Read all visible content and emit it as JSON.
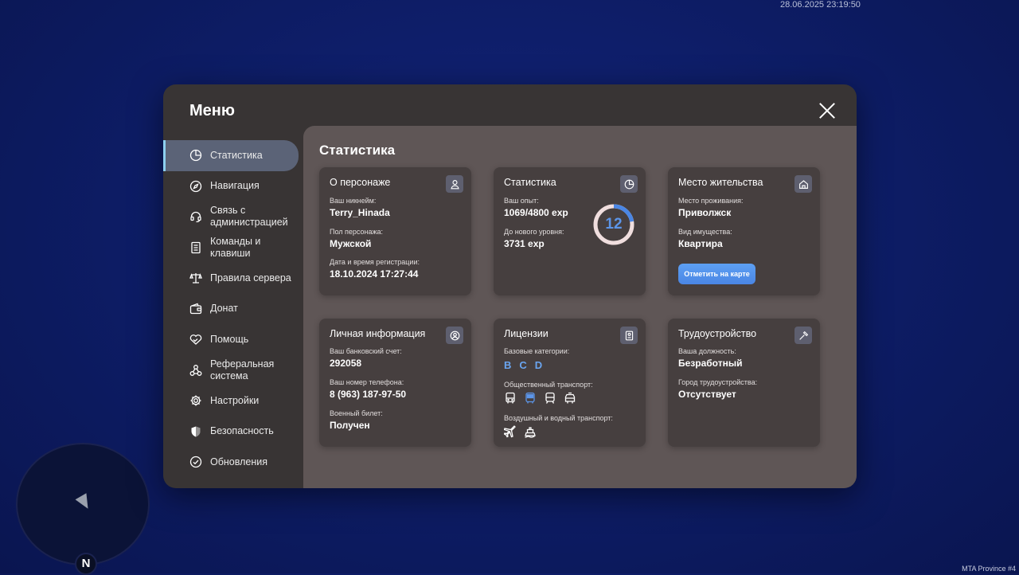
{
  "timestamp": "28.06.2025 23:19:50",
  "watermark": "MTA Province #4",
  "minimap": {
    "north_label": "N"
  },
  "menu": {
    "title": "Меню",
    "sidebar": [
      {
        "label": "Статистика",
        "icon": "pie-chart-icon",
        "active": true
      },
      {
        "label": "Навигация",
        "icon": "compass-icon"
      },
      {
        "label": "Связь с\nадминистрацией",
        "icon": "headset-icon"
      },
      {
        "label": "Команды и\nклавиши",
        "icon": "document-icon"
      },
      {
        "label": "Правила сервера",
        "icon": "scales-icon"
      },
      {
        "label": "Донат",
        "icon": "wallet-icon"
      },
      {
        "label": "Помощь",
        "icon": "handshake-heart-icon"
      },
      {
        "label": "Реферальная\nсистема",
        "icon": "network-icon"
      },
      {
        "label": "Настройки",
        "icon": "gear-icon"
      },
      {
        "label": "Безопасность",
        "icon": "shield-icon"
      },
      {
        "label": "Обновления",
        "icon": "check-circle-icon"
      }
    ]
  },
  "content": {
    "title": "Статистика",
    "character": {
      "title": "О персонаже",
      "nickname_label": "Ваш никнейм:",
      "nickname": "Terry_Hinada",
      "gender_label": "Пол персонажа:",
      "gender": "Мужской",
      "reg_label": "Дата и время регистрации:",
      "reg": "18.10.2024 17:27:44"
    },
    "stats": {
      "title": "Статистика",
      "exp_label": "Ваш опыт:",
      "exp": "1069/4800 exp",
      "next_label": "До нового уровня:",
      "next": "3731 exp",
      "level": "12",
      "level_progress": 0.223
    },
    "residence": {
      "title": "Место жительства",
      "place_label": "Место проживания:",
      "place": "Приволжск",
      "type_label": "Вид имущества:",
      "type": "Квартира",
      "map_button": "Отметить на карте"
    },
    "personal": {
      "title": "Личная информация",
      "bank_label": "Ваш банковский счет:",
      "bank": "292058",
      "phone_label": "Ваш номер телефона:",
      "phone": "8 (963) 187-97-50",
      "military_label": "Военный билет:",
      "military": "Получен"
    },
    "licenses": {
      "title": "Лицензии",
      "base_label": "Базовые категории:",
      "categories": [
        "B",
        "C",
        "D"
      ],
      "public_label": "Общественный транспорт:",
      "air_label": "Воздушный и водный транспорт:"
    },
    "employment": {
      "title": "Трудоустройство",
      "position_label": "Ваша должность:",
      "position": "Безработный",
      "city_label": "Город трудоустройства:",
      "city": "Отсутствует"
    }
  },
  "colors": {
    "accent": "#5c95e8",
    "active_bar": "#8dd0f0"
  }
}
